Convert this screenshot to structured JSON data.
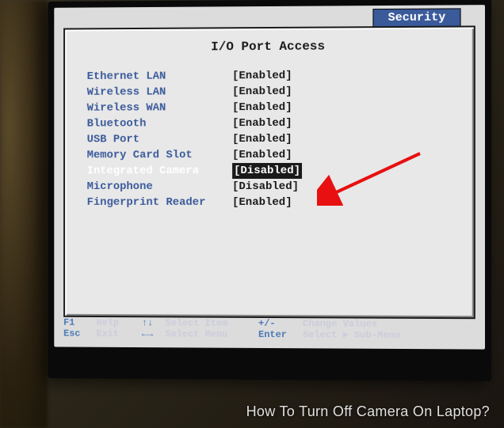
{
  "tab": {
    "label": "Security"
  },
  "panel": {
    "title": "I/O Port Access"
  },
  "settings": [
    {
      "label": "Ethernet LAN",
      "value": "[Enabled]",
      "selected": false
    },
    {
      "label": "Wireless LAN",
      "value": "[Enabled]",
      "selected": false
    },
    {
      "label": "Wireless WAN",
      "value": "[Enabled]",
      "selected": false
    },
    {
      "label": "Bluetooth",
      "value": "[Enabled]",
      "selected": false
    },
    {
      "label": "USB Port",
      "value": "[Enabled]",
      "selected": false
    },
    {
      "label": "Memory Card Slot",
      "value": "[Enabled]",
      "selected": false
    },
    {
      "label": "Integrated Camera",
      "value": "[Disabled]",
      "selected": true
    },
    {
      "label": "Microphone",
      "value": "[Disabled]",
      "selected": false
    },
    {
      "label": "Fingerprint Reader",
      "value": "[Enabled]",
      "selected": false
    }
  ],
  "footer": {
    "f1": "F1",
    "help": "Help",
    "esc": "Esc",
    "exit": "Exit",
    "updown": "↑↓",
    "select_item": "Select Item",
    "leftright": "←→",
    "select_menu": "Select Menu",
    "plusminus": "+/-",
    "change_values": "Change Values",
    "enter": "Enter",
    "select_submenu": "Select ► Sub-Menu"
  },
  "caption": "How To Turn Off Camera On Laptop?",
  "annotation": {
    "arrow_color": "#e81010"
  }
}
